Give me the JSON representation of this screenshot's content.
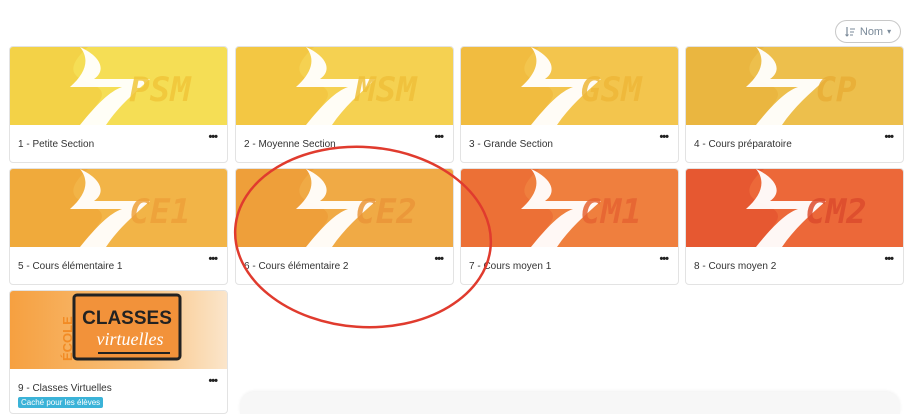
{
  "sort": {
    "label": "Nom",
    "icon": "sort-icon"
  },
  "cards": [
    {
      "code": "PSM",
      "title": "1 - Petite Section",
      "bg": "#f5de55",
      "fg": "#f1c83c",
      "text_color": "#f0c63a"
    },
    {
      "code": "MSM",
      "title": "2 - Moyenne Section",
      "bg": "#f5d151",
      "fg": "#f0bf38",
      "text_color": "#efc03a"
    },
    {
      "code": "GSM",
      "title": "3 - Grande Section",
      "bg": "#f3c54d",
      "fg": "#eeb436",
      "text_color": "#edb638"
    },
    {
      "code": "CP",
      "title": "4 - Cours préparatoire",
      "bg": "#edbf4c",
      "fg": "#e8ae36",
      "text_color": "#e8ad36"
    },
    {
      "code": "CE1",
      "title": "5 - Cours élémentaire 1",
      "bg": "#f2b447",
      "fg": "#eea232",
      "text_color": "#eda03a"
    },
    {
      "code": "CE2",
      "title": "6 - Cours élémentaire 2",
      "bg": "#f0aa45",
      "fg": "#ec9632",
      "text_color": "#ea9538"
    },
    {
      "code": "CM1",
      "title": "7 - Cours moyen 1",
      "bg": "#ef7f3e",
      "fg": "#e9642f",
      "text_color": "#e56331"
    },
    {
      "code": "CM2",
      "title": "8 - Cours moyen 2",
      "bg": "#ec6839",
      "fg": "#e24a2c",
      "text_color": "#dc4b2d"
    }
  ],
  "classes_virtuelles": {
    "title": "9 - Classes Virtuelles",
    "badge": "Caché pour les élèves",
    "logo_ecole": "ÉCOLE",
    "logo_classes": "CLASSES",
    "logo_virtuelles": "virtuelles",
    "bg": "#f6a040",
    "logo_bg": "#f2923a"
  },
  "menu_label": "•••",
  "colors": {
    "annotation": "#e03b2e",
    "badge": "#3bb3d8"
  }
}
